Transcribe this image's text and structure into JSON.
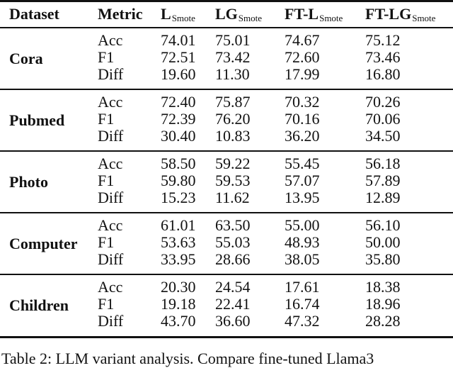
{
  "table": {
    "headers": {
      "dataset": "Dataset",
      "metric": "Metric",
      "l_base": "L",
      "l_sub": "Smote",
      "lg_base": "LG",
      "lg_sub": "Smote",
      "ftl_base": "FT-L",
      "ftl_sub": "Smote",
      "ftlg_base": "FT-LG",
      "ftlg_sub": "Smote"
    },
    "groups": [
      {
        "dataset": "Cora",
        "rows": [
          {
            "metric": "Acc",
            "l": "74.01",
            "lg": "75.01",
            "ftl": "74.67",
            "ftlg": "75.12"
          },
          {
            "metric": "F1",
            "l": "72.51",
            "lg": "73.42",
            "ftl": "72.60",
            "ftlg": "73.46"
          },
          {
            "metric": "Diff",
            "l": "19.60",
            "lg": "11.30",
            "ftl": "17.99",
            "ftlg": "16.80"
          }
        ]
      },
      {
        "dataset": "Pubmed",
        "rows": [
          {
            "metric": "Acc",
            "l": "72.40",
            "lg": "75.87",
            "ftl": "70.32",
            "ftlg": "70.26"
          },
          {
            "metric": "F1",
            "l": "72.39",
            "lg": "76.20",
            "ftl": "70.16",
            "ftlg": "70.06"
          },
          {
            "metric": "Diff",
            "l": "30.40",
            "lg": "10.83",
            "ftl": "36.20",
            "ftlg": "34.50"
          }
        ]
      },
      {
        "dataset": "Photo",
        "rows": [
          {
            "metric": "Acc",
            "l": "58.50",
            "lg": "59.22",
            "ftl": "55.45",
            "ftlg": "56.18"
          },
          {
            "metric": "F1",
            "l": "59.80",
            "lg": "59.53",
            "ftl": "57.07",
            "ftlg": "57.89"
          },
          {
            "metric": "Diff",
            "l": "15.23",
            "lg": "11.62",
            "ftl": "13.95",
            "ftlg": "12.89"
          }
        ]
      },
      {
        "dataset": "Computer",
        "rows": [
          {
            "metric": "Acc",
            "l": "61.01",
            "lg": "63.50",
            "ftl": "55.00",
            "ftlg": "56.10"
          },
          {
            "metric": "F1",
            "l": "53.63",
            "lg": "55.03",
            "ftl": "48.93",
            "ftlg": "50.00"
          },
          {
            "metric": "Diff",
            "l": "33.95",
            "lg": "28.66",
            "ftl": "38.05",
            "ftlg": "35.80"
          }
        ]
      },
      {
        "dataset": "Children",
        "rows": [
          {
            "metric": "Acc",
            "l": "20.30",
            "lg": "24.54",
            "ftl": "17.61",
            "ftlg": "18.38"
          },
          {
            "metric": "F1",
            "l": "19.18",
            "lg": "22.41",
            "ftl": "16.74",
            "ftlg": "18.96"
          },
          {
            "metric": "Diff",
            "l": "43.70",
            "lg": "36.60",
            "ftl": "47.32",
            "ftlg": "28.28"
          }
        ]
      }
    ]
  },
  "caption": "Table 2: LLM variant analysis. Compare fine-tuned Llama3"
}
